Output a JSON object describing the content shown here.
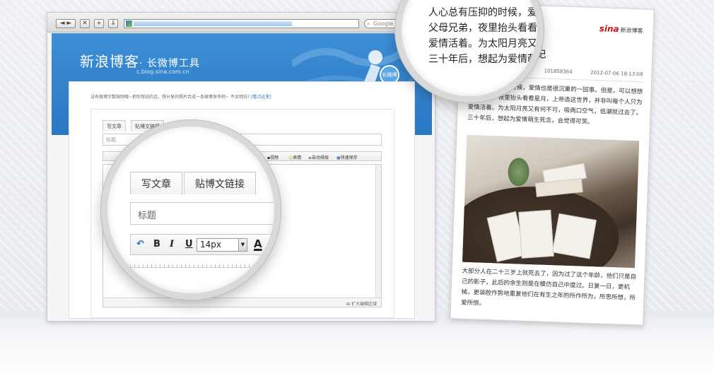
{
  "browser": {
    "nav_back": "◄ ►",
    "nav_stop": "✕",
    "nav_add": "+",
    "nav_down": "⇓",
    "search_placeholder": "Google"
  },
  "blog_header": {
    "logo": "新浪博客",
    "tool_name": "· 长微博工具",
    "url": "c.blog.sina.com.cn",
    "badge": "长微博"
  },
  "hint": {
    "text": "没有微博字数限制哦~把你想说的话，想分享的照片合成一条微博发布吧~ 不太明白?",
    "link": "[看点这里]"
  },
  "editor_small": {
    "tab_write": "写文章",
    "tab_link": "贴博文链接",
    "title_placeholder": "标题",
    "toolbar_video": "视频",
    "toolbar_emoji": "表情",
    "toolbar_layout": "自动排版",
    "toolbar_save": "快速保存",
    "footer": "扩大编辑区域"
  },
  "magnifier_editor": {
    "tab_write": "写文章",
    "tab_link": "贴博文链接",
    "title_placeholder": "标题",
    "bold": "B",
    "italic": "I",
    "underline": "U",
    "font_size": "14px",
    "font_color": "A"
  },
  "magnifier_text": {
    "lines": [
      "人心总有压抑的时候，爱",
      "父母兄弟，夜里抬头看看",
      "爱情活着。为太阳月亮又",
      "三十年后，想起为爱情萌"
    ]
  },
  "article": {
    "brand": "sina",
    "brand_cn": "新浪博客",
    "title_tail": "记",
    "id": "101858364",
    "date": "2012-07-06 18:13:08",
    "para1": "人心总有压抑的时候，爱情也是很沉重的一回事。但是，可以想想父母兄弟，夜里抬头看看星月，上帝造这世界，并非叫每个人只为爱情活着。为太阳月亮又有何不可，吸两口空气，低潮就过去了。三十年后，想起为爱情萌生死念，会觉得可笑。",
    "para2": "大部分人在二十三岁上就死去了，因为过了这个年龄，他们只是自己的影子，此后的余生则是在模仿自己中度过，日复一日，更机械，更装腔作势地重复他们在有生之年的所作所为，所思所想，所爱所恨。"
  }
}
